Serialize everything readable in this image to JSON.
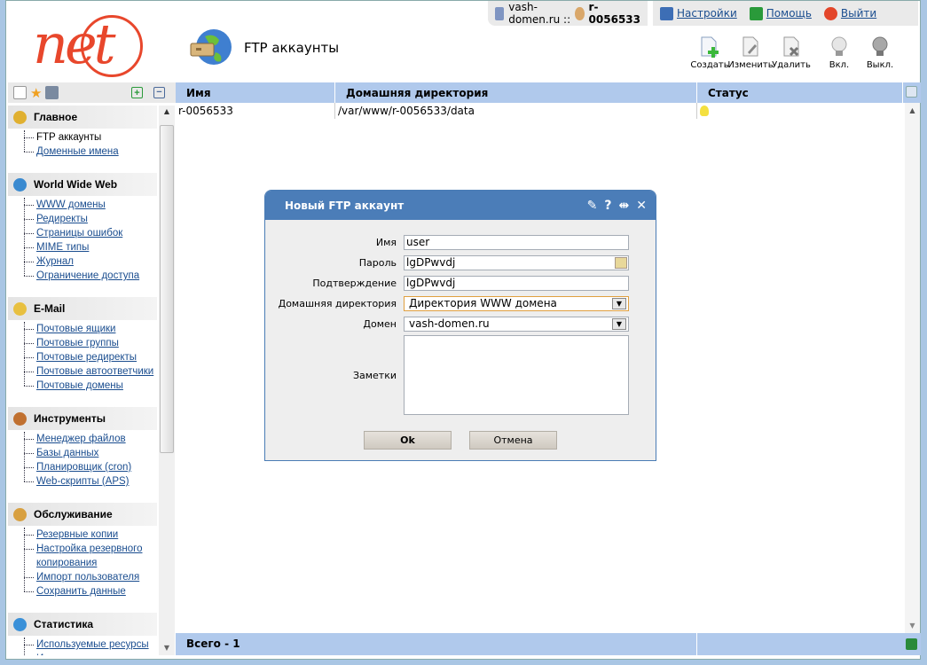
{
  "topbar": {
    "domain": "vash-domen.ru ::",
    "user": "r-0056533",
    "settings": "Настройки",
    "help": "Помощь",
    "logout": "Выйти"
  },
  "logo": "net",
  "page": {
    "title": "FTP аккаунты"
  },
  "toolbar": [
    {
      "label": "Создать",
      "icon": "create-icon"
    },
    {
      "label": "Изменить",
      "icon": "edit-icon"
    },
    {
      "label": "Удалить",
      "icon": "delete-icon"
    },
    {
      "label": "Вкл.",
      "icon": "bulb-on-icon"
    },
    {
      "label": "Выкл.",
      "icon": "bulb-off-icon"
    }
  ],
  "sidebar": {
    "sections": [
      {
        "title": "Главное",
        "items": [
          "FTP аккаунты",
          "Доменные имена"
        ],
        "active": 0
      },
      {
        "title": "World Wide Web",
        "items": [
          "WWW домены",
          "Редиректы",
          "Страницы ошибок",
          "MIME типы",
          "Журнал",
          "Ограничение доступа"
        ]
      },
      {
        "title": "E-Mail",
        "items": [
          "Почтовые ящики",
          "Почтовые группы",
          "Почтовые редиректы",
          "Почтовые автоответчики",
          "Почтовые домены"
        ]
      },
      {
        "title": "Инструменты",
        "items": [
          "Менеджер файлов",
          "Базы данных",
          "Планировщик (cron)",
          "Web-скрипты (APS)"
        ]
      },
      {
        "title": "Обслуживание",
        "items": [
          "Резервные копии",
          "Настройка резервного копирования",
          "Импорт пользователя",
          "Сохранить данные"
        ]
      },
      {
        "title": "Статистика",
        "items": [
          "Используемые ресурсы",
          "Использование диска"
        ]
      }
    ]
  },
  "grid": {
    "columns": [
      "Имя",
      "Домашняя директория",
      "Статус"
    ],
    "rows": [
      {
        "name": "r-0056533",
        "dir": "/var/www/r-0056533/data",
        "status": "on"
      }
    ],
    "footer": "Всего - 1"
  },
  "dialog": {
    "title": "Новый FTP аккаунт",
    "fields": {
      "name_label": "Имя",
      "name": "user",
      "pass_label": "Пароль",
      "pass": "lgDPwvdj",
      "confirm_label": "Подтверждение",
      "confirm": "lgDPwvdj",
      "home_label": "Домашняя директория",
      "home": "Директория WWW домена",
      "domain_label": "Домен",
      "domain": "vash-domen.ru",
      "notes_label": "Заметки",
      "notes": ""
    },
    "ok": "Ok",
    "cancel": "Отмена"
  },
  "colors": {
    "accent": "#4b7db8",
    "grid_header": "#b0c9ec",
    "logo": "#e8472c"
  }
}
